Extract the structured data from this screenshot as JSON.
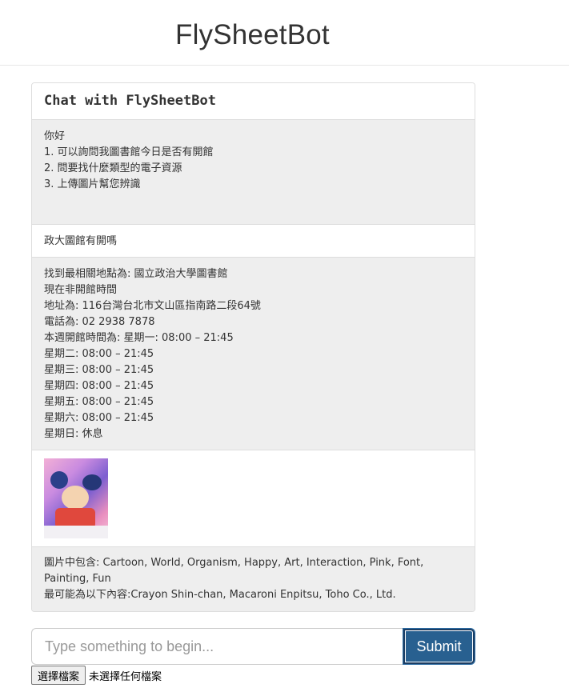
{
  "app": {
    "title": "FlySheetBot"
  },
  "chat": {
    "panel_title": "Chat with FlySheetBot",
    "messages": [
      {
        "role": "bot",
        "lines": [
          "你好",
          "1. 可以詢問我圖書館今日是否有開館",
          "2. 問要找什麼類型的電子資源",
          "3. 上傳圖片幫您辨識"
        ]
      },
      {
        "role": "user",
        "text": "政大圖館有開嗎"
      },
      {
        "role": "bot",
        "lines": [
          "找到最相關地點為: 國立政治大學圖書館",
          "現在非開館時間",
          "地址為: 116台灣台北市文山區指南路二段64號",
          "電話為: 02 2938 7878",
          "本週開館時間為: 星期一: 08:00 – 21:45",
          "星期二: 08:00 – 21:45",
          "星期三: 08:00 – 21:45",
          "星期四: 08:00 – 21:45",
          "星期五: 08:00 – 21:45",
          "星期六: 08:00 – 21:45",
          "星期日: 休息"
        ]
      },
      {
        "role": "user",
        "type": "image",
        "image_name": "uploaded-image"
      },
      {
        "role": "bot",
        "lines": [
          "圖片中包含: Cartoon, World, Organism, Happy, Art, Interaction, Pink, Font, Painting, Fun",
          "最可能為以下內容:Crayon Shin-chan, Macaroni Enpitsu, Toho Co., Ltd."
        ]
      }
    ]
  },
  "composer": {
    "placeholder": "Type something to begin...",
    "value": "",
    "submit_label": "Submit",
    "file_button_label": "選擇檔案",
    "file_status": "未選擇任何檔案"
  },
  "colors": {
    "bot_bubble": "#eeeeee",
    "user_bubble": "#ffffff",
    "border": "#dddddd",
    "submit_button": "#286090"
  }
}
